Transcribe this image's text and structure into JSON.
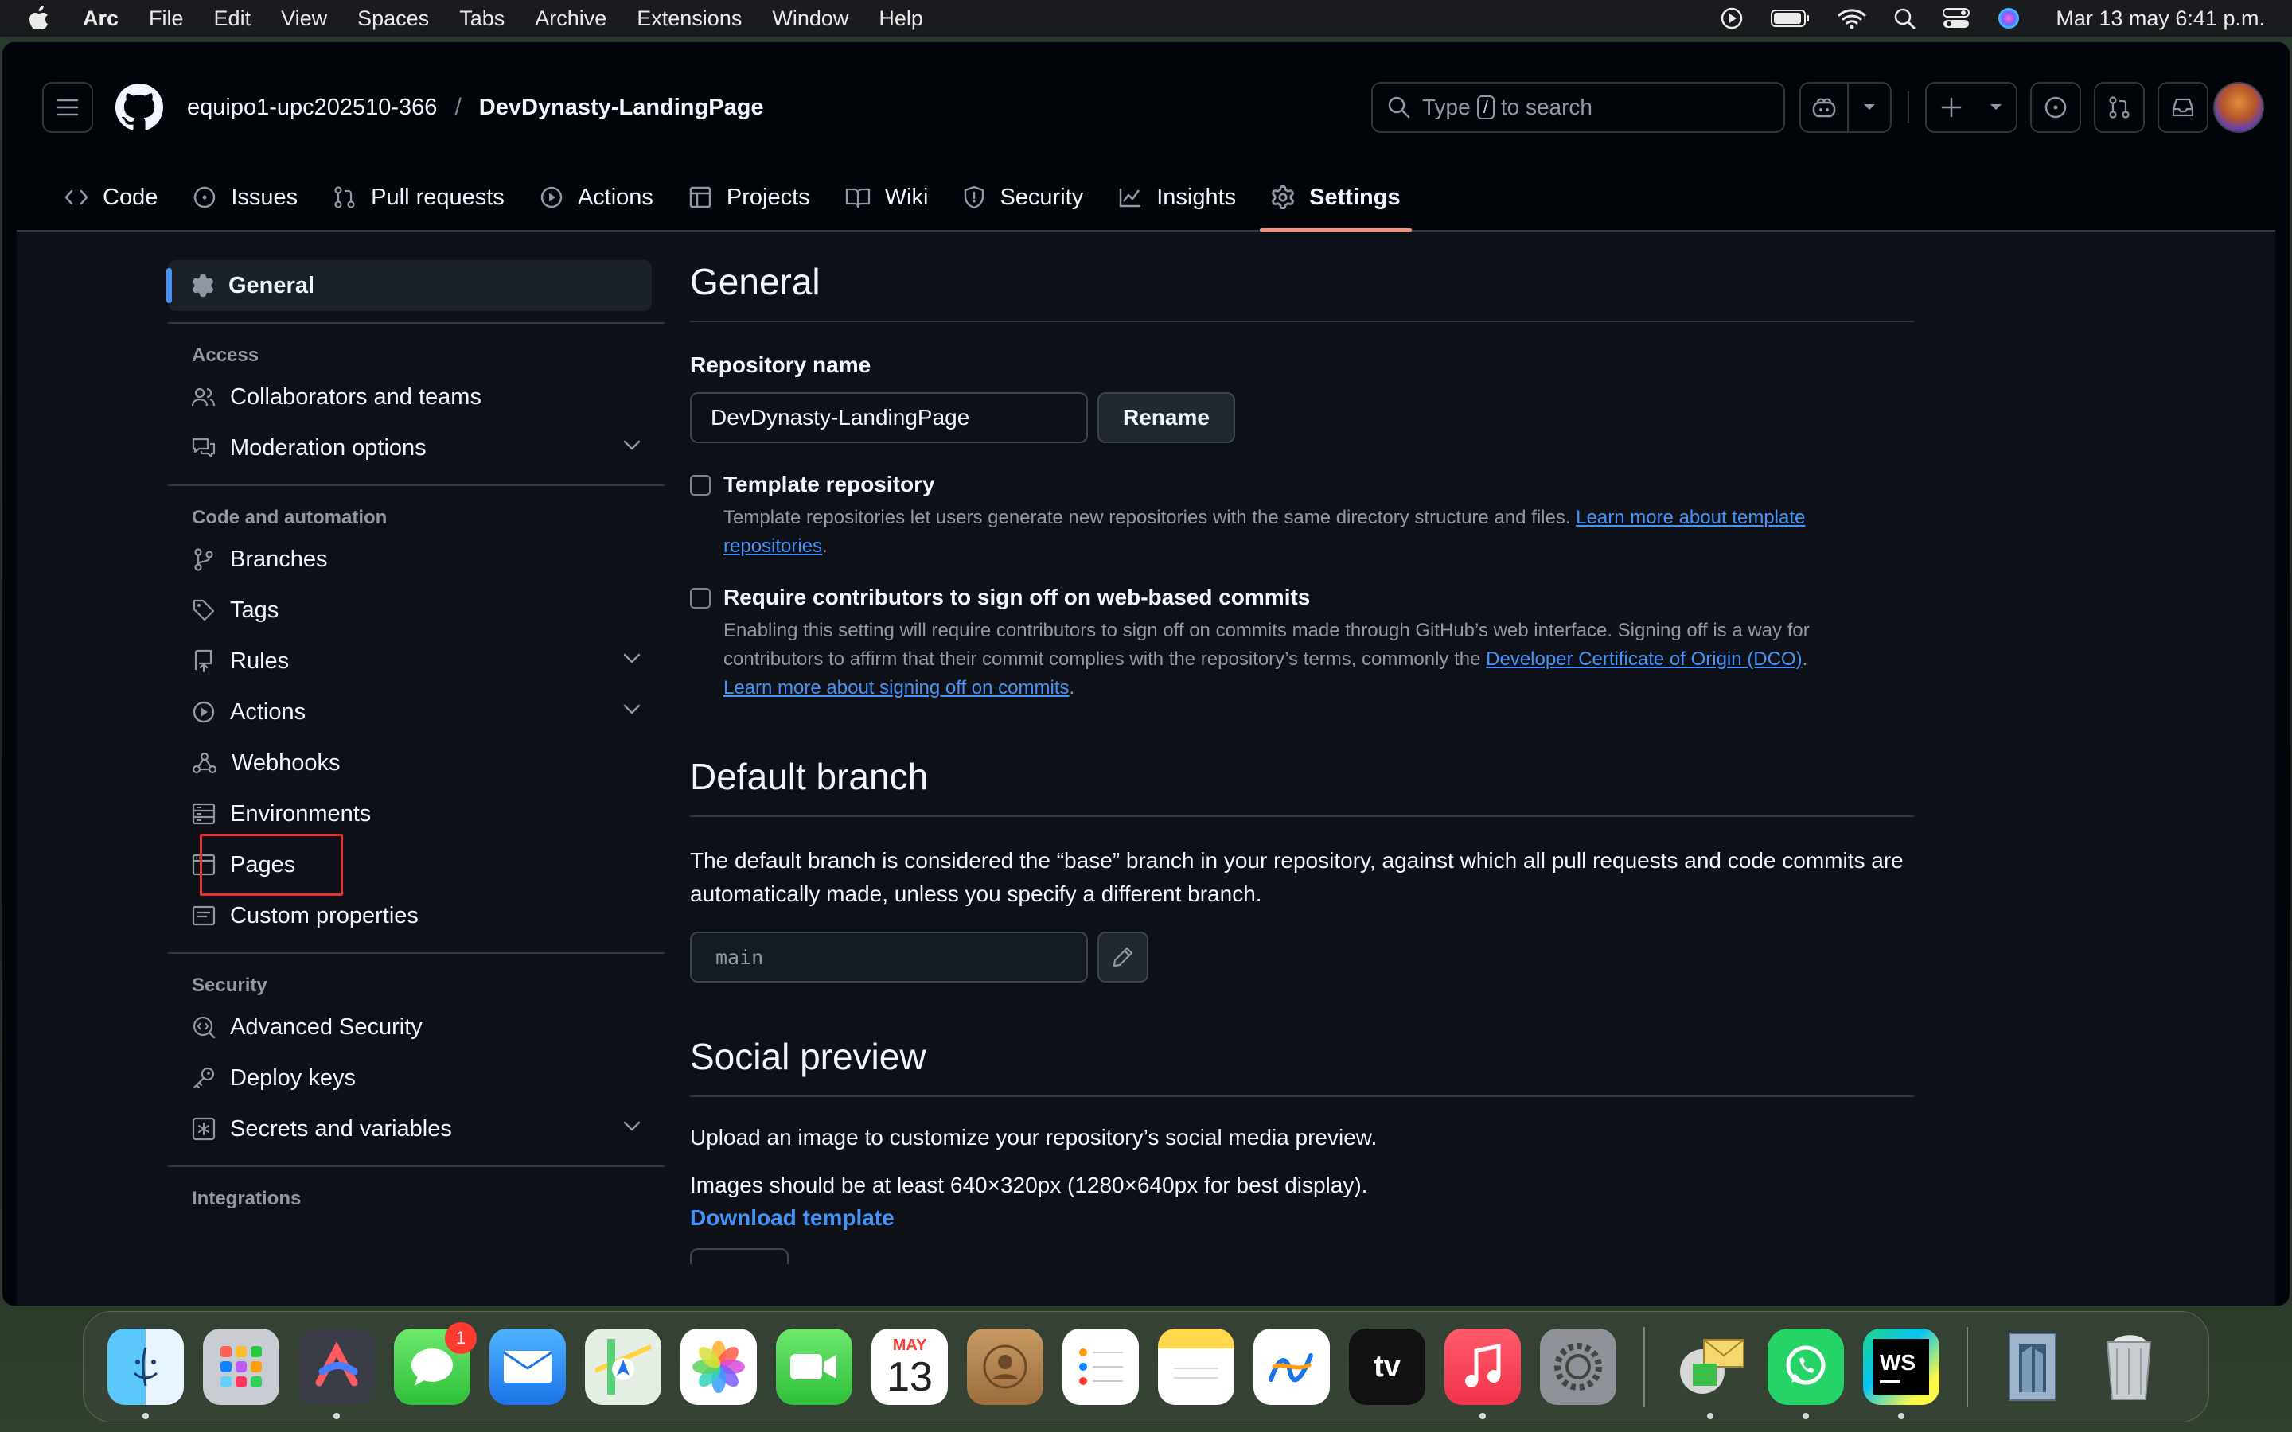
{
  "menubar": {
    "app": "Arc",
    "items": [
      "File",
      "Edit",
      "View",
      "Spaces",
      "Tabs",
      "Archive",
      "Extensions",
      "Window",
      "Help"
    ],
    "clock": "Mar 13 may 6:41 p.m."
  },
  "header": {
    "owner": "equipo1-upc202510-366",
    "separator": "/",
    "repo": "DevDynasty-LandingPage",
    "search_prefix": "Type",
    "search_key": "/",
    "search_suffix": "to search"
  },
  "tabs": [
    {
      "label": "Code",
      "icon": "code-icon"
    },
    {
      "label": "Issues",
      "icon": "issue-icon"
    },
    {
      "label": "Pull requests",
      "icon": "pull-request-icon"
    },
    {
      "label": "Actions",
      "icon": "play-icon"
    },
    {
      "label": "Projects",
      "icon": "table-icon"
    },
    {
      "label": "Wiki",
      "icon": "book-icon"
    },
    {
      "label": "Security",
      "icon": "shield-icon"
    },
    {
      "label": "Insights",
      "icon": "graph-icon"
    },
    {
      "label": "Settings",
      "icon": "gear-icon",
      "active": true
    }
  ],
  "sidebar": {
    "general": "General",
    "access_heading": "Access",
    "access_items": [
      "Collaborators and teams",
      "Moderation options"
    ],
    "code_heading": "Code and automation",
    "code_items": [
      "Branches",
      "Tags",
      "Rules",
      "Actions",
      "Webhooks",
      "Environments",
      "Pages",
      "Custom properties"
    ],
    "security_heading": "Security",
    "security_items": [
      "Advanced Security",
      "Deploy keys",
      "Secrets and variables"
    ],
    "integrations_heading": "Integrations"
  },
  "main": {
    "general_title": "General",
    "repo_name_label": "Repository name",
    "repo_name_value": "DevDynasty-LandingPage",
    "rename_label": "Rename",
    "template_title": "Template repository",
    "template_desc": "Template repositories let users generate new repositories with the same directory structure and files.",
    "template_link": "Learn more about template repositories",
    "signoff_title": "Require contributors to sign off on web-based commits",
    "signoff_desc": "Enabling this setting will require contributors to sign off on commits made through GitHub’s web interface. Signing off is a way for contributors to affirm that their commit complies with the repository’s terms, commonly the",
    "signoff_link1": "Developer Certificate of Origin (DCO)",
    "signoff_link2": "Learn more about signing off on commits",
    "default_branch_title": "Default branch",
    "default_branch_desc": "The default branch is considered the “base” branch in your repository, against which all pull requests and code commits are automatically made, unless you specify a different branch.",
    "default_branch_value": "main",
    "social_title": "Social preview",
    "social_desc": "Upload an image to customize your repository’s social media preview.",
    "social_size": "Images should be at least 640×320px (1280×640px for best display).",
    "download_template": "Download template"
  },
  "dock": {
    "messages_badge": "1",
    "calendar_month": "MAY",
    "calendar_day": "13",
    "appletv_label": "tv",
    "webstorm_label": "WS"
  },
  "colors": {
    "accent_blue": "#4493f8",
    "active_tab_underline": "#fd8c73",
    "highlight_box": "#e5322d"
  }
}
